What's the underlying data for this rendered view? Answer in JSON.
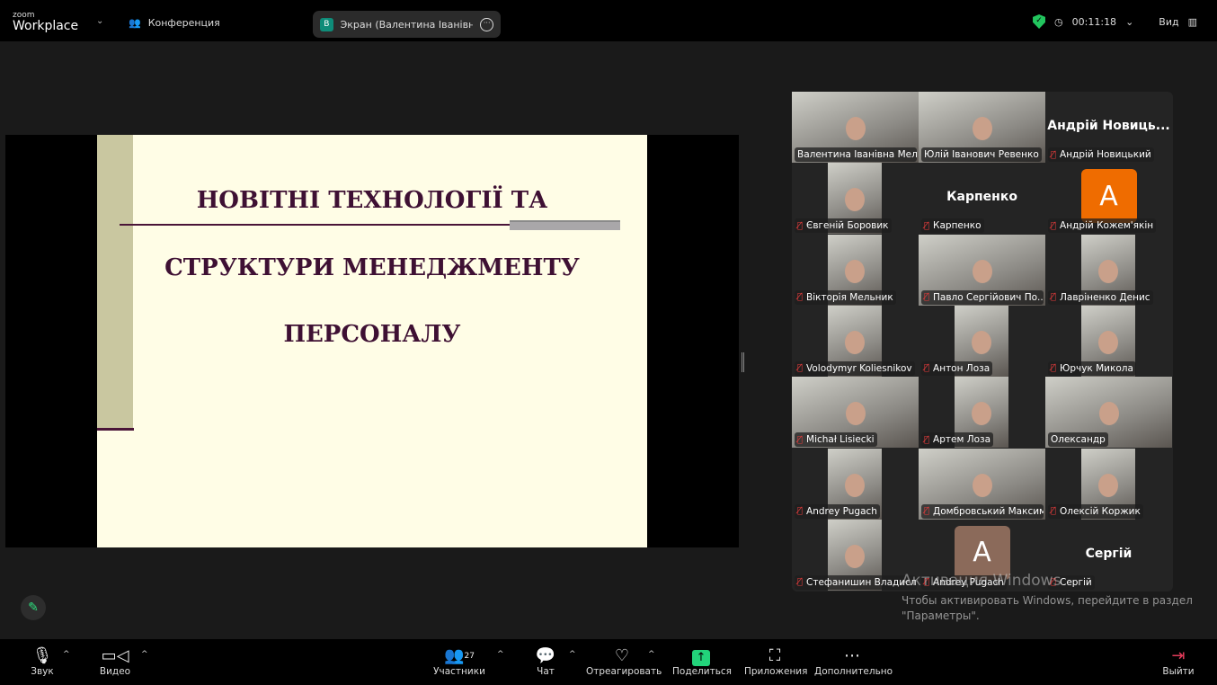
{
  "topbar": {
    "logo_small": "zoom",
    "logo_big": "Workplace",
    "meeting_label": "Конференция",
    "share_initial": "В",
    "share_title": "Экран (Валентина Іванівна Мельник)",
    "timer": "00:11:18",
    "view_label": "Вид"
  },
  "slide": {
    "line1": "НОВІТНІ ТЕХНОЛОГІЇ ТА",
    "line2": "СТРУКТУРИ МЕНЕДЖМЕНТУ",
    "line3": "ПЕРСОНАЛУ"
  },
  "gallery": [
    {
      "name": "Валентина Іванівна Мель...",
      "type": "video",
      "muted": false,
      "active": true
    },
    {
      "name": "Юлій Іванович Ревенко",
      "type": "video",
      "muted": false
    },
    {
      "name": "Андрій Новицький",
      "type": "name",
      "big": "Андрій Новиць...",
      "muted": true
    },
    {
      "name": "Євгеній Боровик",
      "type": "video-narrow",
      "muted": true
    },
    {
      "name": "Карпенко",
      "type": "name",
      "big": "Карпенко",
      "muted": true
    },
    {
      "name": "Андрій Кожем'якін",
      "type": "avatar",
      "letter": "A",
      "color": "#ef6c00",
      "muted": true
    },
    {
      "name": "Вікторія Мельник",
      "type": "video-narrow",
      "muted": true
    },
    {
      "name": "Павло Сергійович По...",
      "type": "video",
      "muted": true
    },
    {
      "name": "Лавріненко Денис",
      "type": "video-narrow",
      "muted": true
    },
    {
      "name": "Volodymyr Koliesnikov",
      "type": "video-narrow",
      "muted": true
    },
    {
      "name": "Антон Лоза",
      "type": "video-narrow",
      "muted": true
    },
    {
      "name": "Юрчук Микола",
      "type": "video-narrow",
      "muted": true
    },
    {
      "name": "Michał Lisiecki",
      "type": "video",
      "muted": true
    },
    {
      "name": "Артем Лоза",
      "type": "video-narrow",
      "muted": true
    },
    {
      "name": "Олександр",
      "type": "video",
      "muted": false
    },
    {
      "name": "Andrey Pugach",
      "type": "video-narrow",
      "muted": true
    },
    {
      "name": "Домбровський Максим",
      "type": "video",
      "muted": true
    },
    {
      "name": "Олексій Коржик",
      "type": "video-narrow",
      "muted": true
    },
    {
      "name": "Стефанишин Владисл...",
      "type": "video-narrow",
      "muted": true
    },
    {
      "name": "Andrey Pugach",
      "type": "avatar",
      "letter": "A",
      "color": "#8b6a5a",
      "muted": true
    },
    {
      "name": "Сергій",
      "type": "name",
      "big": "Сергій",
      "muted": true
    }
  ],
  "watermark": {
    "title": "Активация Windows",
    "text1": "Чтобы активировать Windows, перейдите в раздел",
    "text2": "\"Параметры\"."
  },
  "toolbar": {
    "audio": "Звук",
    "video": "Видео",
    "participants": "Участники",
    "participants_count": "27",
    "chat": "Чат",
    "react": "Отреагировать",
    "share": "Поделиться",
    "apps": "Приложения",
    "more": "Дополнительно",
    "leave": "Выйти"
  },
  "colors": {
    "active_speaker": "#2ee07f",
    "share_green": "#22d37a",
    "muted_red": "#e23b3b"
  }
}
